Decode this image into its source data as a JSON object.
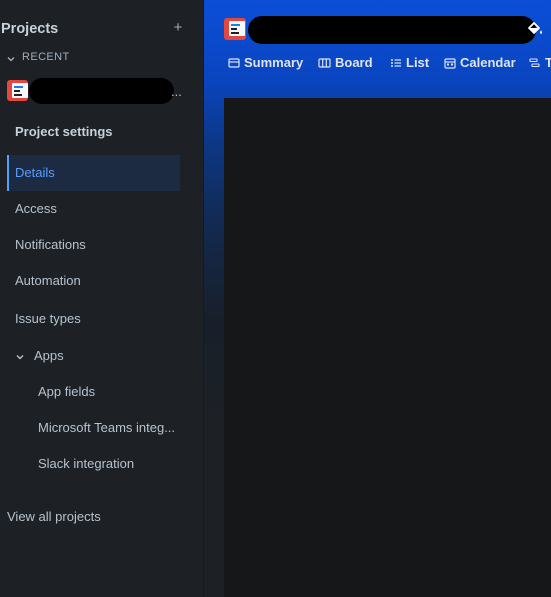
{
  "sidebar": {
    "title": "Projects",
    "add_symbol": "+",
    "recent_label": "RECENT",
    "recent_project_suffix": "...",
    "settings_heading": "Project settings",
    "items": [
      {
        "label": "Details",
        "active": true
      },
      {
        "label": "Access"
      },
      {
        "label": "Notifications"
      },
      {
        "label": "Automation"
      },
      {
        "label": "Issue types"
      },
      {
        "label": "Apps",
        "expanded": true
      },
      {
        "label": "App fields"
      },
      {
        "label": "Microsoft Teams integ..."
      },
      {
        "label": "Slack integration"
      }
    ],
    "view_all": "View all projects"
  },
  "header": {
    "tabs": [
      {
        "label": "Summary",
        "icon": "summary-icon"
      },
      {
        "label": "Board",
        "icon": "board-icon"
      },
      {
        "label": "List",
        "icon": "list-icon"
      },
      {
        "label": "Calendar",
        "icon": "calendar-icon"
      },
      {
        "label": "T",
        "icon": "timeline-icon"
      }
    ],
    "theme_icon": "paint-bucket-icon"
  },
  "colors": {
    "accent": "#579dff",
    "header_blue": "#0b4fd7",
    "project_icon": "#e2483d",
    "background": "#1d2125"
  }
}
